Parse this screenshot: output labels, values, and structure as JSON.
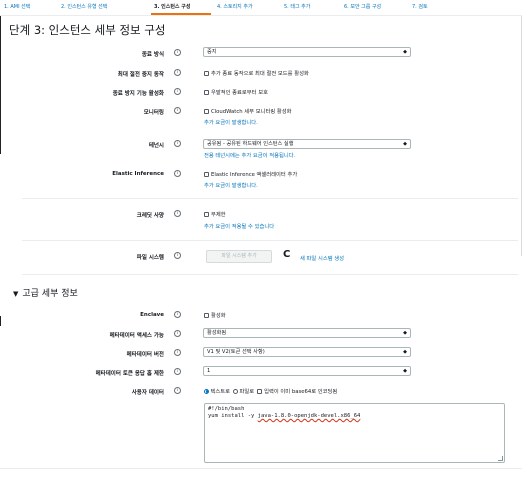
{
  "steps": [
    {
      "label": "1. AMI 선택",
      "active": false
    },
    {
      "label": "2. 인스턴스 유형 선택",
      "active": false
    },
    {
      "label": "3. 인스턴스 구성",
      "active": true
    },
    {
      "label": "4. 스토리지 추가",
      "active": false
    },
    {
      "label": "5. 태그 추가",
      "active": false
    },
    {
      "label": "6. 보안 그룹 구성",
      "active": false
    },
    {
      "label": "7. 검토",
      "active": false
    }
  ],
  "page_title": "단계 3: 인스턴스 세부 정보 구성",
  "info_glyph": "i",
  "fields": {
    "shutdown_behavior": {
      "label": "종료 방식",
      "value": "중지"
    },
    "stop_hibernate": {
      "label": "최대 절전 중지 동작",
      "checkbox": "추가 종료 동작으로 최대 절전 모드를 활성화"
    },
    "termination_protection": {
      "label": "종료 방지 기능 활성화",
      "checkbox": "우발적인 종료로부터 보호"
    },
    "monitoring": {
      "label": "모니터링",
      "checkbox": "CloudWatch 세부 모니터링 활성화",
      "note": "추가 요금이 발생합니다."
    },
    "tenancy": {
      "label": "테넌시",
      "value": "공유됨 - 공유된 하드웨어 인스턴스 실행",
      "note": "전용 테넌시에는 추가 요금이 적용됩니다."
    },
    "elastic_inference": {
      "label": "Elastic Inference",
      "checkbox": "Elastic Inference 액셀러레이터 추가",
      "note": "추가 요금이 발생합니다."
    },
    "credit_spec": {
      "label": "크레딧 사양",
      "checkbox": "무제한",
      "note": "추가 요금이 적용될 수 있습니다"
    },
    "file_systems": {
      "label": "파일 시스템",
      "add_button": "파일 시스템 추가",
      "create_link": "새 파일 시스템 생성"
    }
  },
  "advanced": {
    "title": "고급 세부 정보",
    "enclave": {
      "label": "Enclave",
      "checkbox": "활성화"
    },
    "metadata_accessible": {
      "label": "메타데이터 액세스 가능",
      "value": "활성화됨"
    },
    "metadata_version": {
      "label": "메타데이터 버전",
      "value": "V1 및 V2(토큰 선택 사항)"
    },
    "metadata_hop_limit": {
      "label": "메타데이터 토큰 응답 홉 제한",
      "value": "1"
    },
    "user_data": {
      "label": "사용자 데이터",
      "radio_text": "텍스트로",
      "radio_file": "파일로",
      "base64_checkbox": "입력이 이미 base64로 인코딩됨",
      "line1": "#!/bin/bash",
      "line2_prefix": "yum install -y ",
      "line2_pkg": "java-1.8.0-openjdk-devel.x86_64"
    }
  },
  "icons": {
    "caret": "◆",
    "refresh": "C",
    "expand": "▼"
  }
}
